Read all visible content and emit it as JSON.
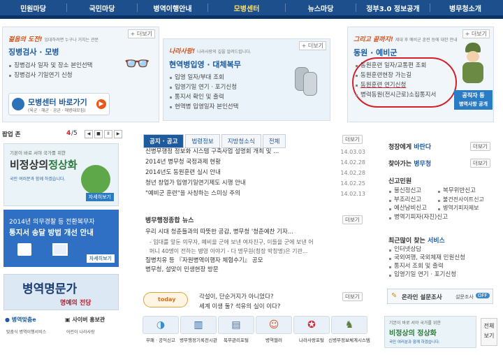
{
  "gnb": [
    "민원마당",
    "국민마당",
    "병역이행안내",
    "모병센터",
    "뉴스마당",
    "정부3.0 정보공개",
    "병무청소개"
  ],
  "box1": {
    "more": "+ 더보기",
    "slogan": "젊음의 도전!",
    "slogan_sub": "입대하려면 누구나 거치는 관문",
    "title": "징병검사 · 모병",
    "items": [
      "징병검사 일자 및 장소 본인선택",
      "징병검사 기일연기 신청"
    ],
    "banner_title": "모병센터 바로가기",
    "banner_sub": "(육군 · 해군 · 공군 · 해병대모집)"
  },
  "box2": {
    "more": "+ 더보기",
    "slogan": "나라사랑!",
    "slogan_sub": "나라사랑의 길을 알려드립니다.",
    "title": "현역병입영 · 대체복무",
    "items": [
      "입영 일자/부대 조회",
      "입영기일 연기 · 포기신청",
      "통지서 확인 및 출력",
      "현역병 입영일자 본인선택"
    ]
  },
  "box3": {
    "more": "+ 더보기",
    "slogan": "그리고 끝까지!",
    "slogan_sub": "제대 후 예비군 훈련 등에 대한 안내",
    "title": "동원 · 예비군",
    "items": [
      "동원훈련 일자/교통편 조회",
      "동원훈련현장 가는길",
      "동원훈련 연기신청",
      "병력동원(전시근로)소집통지서"
    ],
    "badge_1": "공직자 등",
    "badge_2": "병역사항 공개"
  },
  "popup": {
    "label": "팝업 존",
    "page": "4",
    "total": "/5",
    "ctrl_prev": "◀",
    "ctrl_stop": "■",
    "ctrl_pause": "II",
    "ctrl_next": "▶"
  },
  "banner_a": {
    "top": "기본이 바로 서야 국가를 위한",
    "main1": "비정상의",
    "main2": "정상화",
    "sub": "국민 여러분과 함께 하겠습니다.",
    "btn": "자세히보기"
  },
  "banner_b": {
    "line1": "2014년 의무경찰 등 전환복무자",
    "line2": "통지서 송달 방법 개선 안내",
    "btn": "자세히보기"
  },
  "banner_c": {
    "title": "병역명문가",
    "sub": "명예의 전당"
  },
  "bottom_left": {
    "l1": "병역맞춤e",
    "l2": "사이버 홍보관",
    "s1": "맞춤식 병역이행서비스",
    "s2": "어린이 나라사랑"
  },
  "tabs": [
    "공지 · 공고",
    "법령정보",
    "지방청소식",
    "전체"
  ],
  "notice_more": "더보기",
  "notices": [
    {
      "t": "신병무행정 정보화 시스템 구축사업 설명회 개최 및 ...",
      "d": "14.03.03"
    },
    {
      "t": "2014년 병무청 국정과제 현황",
      "d": "14.02.28"
    },
    {
      "t": "2014년도 동원훈련 실시 안내",
      "d": "14.02.28"
    },
    {
      "t": "청년 창업가 입영기일연기제도 시행 안내",
      "d": "14.02.25"
    },
    {
      "t": "\"예비군 훈련\"을 사칭하는 스미싱 주의",
      "d": "14.02.13"
    }
  ],
  "general": {
    "title": "병무행정종합 뉴스",
    "more": "더보기",
    "items": [
      "우리 시대 청춘들과의 따뜻한 공감, 병무청 '청춘예찬 기자...",
      "- 입대를 앞둔 의무자, 예비을 군에 보낸 여자친구, 이들을 군에 보낸 어",
      "머니 40명이 전하는 병영 이야기 - 다 명무원(청장 박창명)은 기관...",
      "질병치유 등 『자원병역이행자 체험수기』 공모",
      "병무청, 설맞이 민생현장 방문"
    ]
  },
  "today": {
    "logo": "today",
    "q1": "각설이, 단순거지가 아니었다?",
    "q2": "세계 이생 둘? 석유의 실이 이다?",
    "more": "더보기"
  },
  "right": {
    "c1": "청장에게",
    "c1b": "바란다",
    "c2": "찾아가는",
    "c2b": "병무청",
    "more": "더보기",
    "civil_title": "신고민원",
    "civil": [
      "불신정신고",
      "복무위반신고",
      "부조리신고",
      "불건전사이트신고",
      "예산낭비신고",
      "병역기피자제보",
      "병역기피자(자진)신고"
    ],
    "svc_title": "최근많이 찾는",
    "svc_title_b": "서비스",
    "svc": [
      "인터넷상담",
      "국외여행, 국외체재 민원신청",
      "통지서 조회 및 출력",
      "입영기일 연기 · 포기신청"
    ],
    "survey": "온라인 설문조사",
    "survey2": "설문조사",
    "toggle": "OFF"
  },
  "bottom_icons": [
    "부패 · 공익신고",
    "병무행정기록전시관",
    "복무관리포털",
    "병역멜러",
    "나라사랑포털",
    "신병무정보체계시스템"
  ],
  "bottom_right": {
    "top": "기본이 바로 서야 국가를 위한",
    "main": "비정상의 정상화",
    "sub": "국민 여러분과 함께 하겠습니다.",
    "v1": "전체",
    "v2": "보기"
  }
}
